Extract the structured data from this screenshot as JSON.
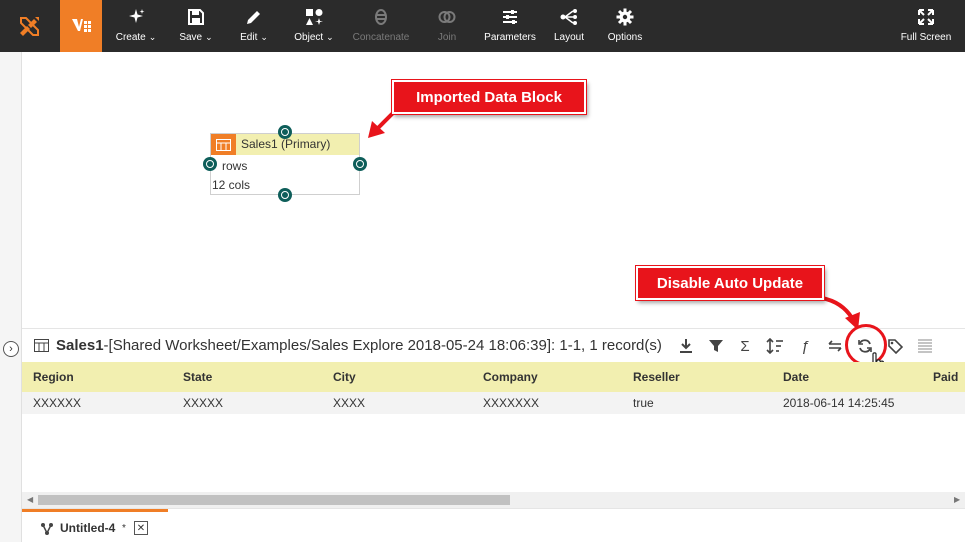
{
  "toolbar": {
    "buttons": [
      {
        "label": "Create",
        "icon": "sparkle-icon",
        "dropdown": true
      },
      {
        "label": "Save",
        "icon": "floppy-icon",
        "dropdown": true
      },
      {
        "label": "Edit",
        "icon": "pencil-icon",
        "dropdown": true
      },
      {
        "label": "Object",
        "icon": "shapes-icon",
        "dropdown": true
      },
      {
        "label": "Concatenate",
        "icon": "concatenate-icon",
        "disabled": true
      },
      {
        "label": "Join",
        "icon": "join-icon",
        "disabled": true
      },
      {
        "label": "Parameters",
        "icon": "sliders-icon"
      },
      {
        "label": "Layout",
        "icon": "layout-tree-icon"
      },
      {
        "label": "Options",
        "icon": "gear-icon"
      }
    ],
    "fullscreen_label": "Full Screen",
    "caret": "⌄"
  },
  "block": {
    "title": "Sales1 (Primary)",
    "rows": "rows",
    "cols": "12 cols"
  },
  "callouts": {
    "imported": "Imported Data Block",
    "disable": "Disable Auto Update"
  },
  "panel": {
    "name": "Sales1",
    "path": "-[Shared Worksheet/Examples/Sales Explore 2018-05-24 18:06:39]: 1-1, 1 record(s)"
  },
  "grid": {
    "columns": [
      "Region",
      "State",
      "City",
      "Company",
      "Reseller",
      "Date",
      "Paid"
    ],
    "rows": [
      [
        "XXXXXX",
        "XXXXX",
        "XXXX",
        "XXXXXXX",
        "true",
        "2018-06-14 14:25:45",
        ""
      ]
    ]
  },
  "tab": {
    "label": "Untitled-4",
    "modified_mark": "*",
    "close": "✕"
  },
  "colors": {
    "accent": "#f07e26",
    "toolbar_bg": "#2b2b2b",
    "callout_red": "#e8141b",
    "header_yellow": "#f2efb0",
    "join_green": "#0e5e5a"
  }
}
